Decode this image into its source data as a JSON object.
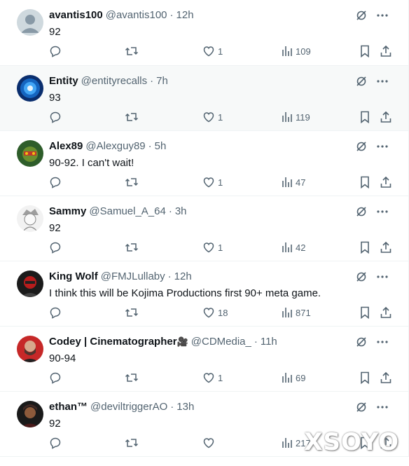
{
  "tweets": [
    {
      "name": "avantis100",
      "handle": "@avantis100",
      "sep": "·",
      "time": "12h",
      "text": "92",
      "likes": "1",
      "views": "109"
    },
    {
      "name": "Entity",
      "handle": "@entityrecalls",
      "sep": "·",
      "time": "7h",
      "text": "93",
      "likes": "1",
      "views": "119"
    },
    {
      "name": "Alex89",
      "handle": "@Alexguy89",
      "sep": "·",
      "time": "5h",
      "text": "90-92. I can't wait!",
      "likes": "1",
      "views": "47"
    },
    {
      "name": "Sammy",
      "handle": "@Samuel_A_64",
      "sep": "·",
      "time": "3h",
      "text": "92",
      "likes": "1",
      "views": "42"
    },
    {
      "name": "King Wolf",
      "handle": "@FMJLullaby",
      "sep": "·",
      "time": "12h",
      "text": "I think this will be Kojima Productions first 90+ meta game.",
      "likes": "18",
      "views": "871"
    },
    {
      "name": "Codey | Cinematographer",
      "handle": "@CDMedia_",
      "sep": "·",
      "time": "11h",
      "text": "90-94",
      "likes": "1",
      "views": "69"
    },
    {
      "name": "ethan™",
      "handle": "@deviltriggerAO",
      "sep": "·",
      "time": "13h",
      "text": "92",
      "likes": "",
      "views": "217"
    }
  ],
  "icons": {
    "grok": "grok-icon",
    "more": "more-icon",
    "reply": "reply-icon",
    "retweet": "retweet-icon",
    "like": "heart-icon",
    "views": "views-icon",
    "bookmark": "bookmark-icon",
    "share": "share-icon"
  },
  "colors": {
    "text": "#0f1419",
    "muted": "#536471",
    "border": "#eff3f4",
    "highlight": "#f7f9f9"
  },
  "watermark": "XSOYO"
}
